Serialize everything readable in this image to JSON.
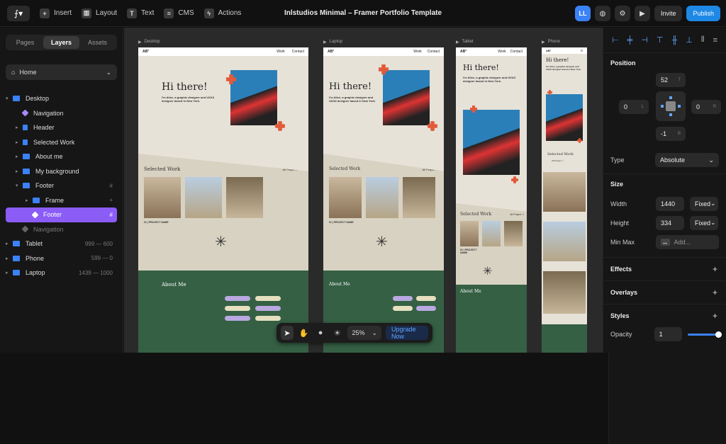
{
  "app": {
    "title": "Inlstudios Minimal – Framer Portfolio Template"
  },
  "topbar": {
    "insert": "Insert",
    "layout": "Layout",
    "text": "Text",
    "cms": "CMS",
    "actions": "Actions",
    "avatar": "LL",
    "invite": "Invite",
    "publish": "Publish"
  },
  "left_panel": {
    "tabs": [
      "Pages",
      "Layers",
      "Assets"
    ],
    "active_tab": "Layers",
    "page": "Home",
    "layers": [
      {
        "label": "Desktop",
        "tag": "Primary",
        "depth": 0
      },
      {
        "label": "Navigation",
        "depth": 1
      },
      {
        "label": "Header",
        "depth": 1
      },
      {
        "label": "Selected Work",
        "depth": 1
      },
      {
        "label": "About me",
        "depth": 1
      },
      {
        "label": "My background",
        "depth": 1
      },
      {
        "label": "Footer",
        "depth": 1,
        "tag": "#"
      },
      {
        "label": "Frame",
        "depth": 2,
        "tag": "+"
      },
      {
        "label": "Footer",
        "depth": 2,
        "tag": "#",
        "selected": true
      },
      {
        "label": "Navigation",
        "depth": 1,
        "dim": true
      },
      {
        "label": "Tablet",
        "tag": "999 — 600",
        "depth": 0
      },
      {
        "label": "Phone",
        "tag": "599 — 0",
        "depth": 0
      },
      {
        "label": "Laptop",
        "tag": "1439 — 1000",
        "depth": 0
      }
    ]
  },
  "canvas": {
    "frames": [
      {
        "label": "Desktop",
        "logo": "AB°",
        "nav_work": "Work",
        "nav_contact": "Contact",
        "hero_title": "Hi there!",
        "hero_sub": "I'm Alice, a graphic designer and UX/UI designer based in New York.",
        "work_title": "Selected Work",
        "all_projects": "All Project ↗",
        "project_name": "01 | PROJECT NAME",
        "about_title": "About Me"
      },
      {
        "label": "Laptop",
        "logo": "AB°",
        "nav_work": "Work",
        "nav_contact": "Contact",
        "hero_title": "Hi there!",
        "hero_sub": "I'm Alice, a graphic designer and UX/UI designer based in New York.",
        "work_title": "Selected Work",
        "all_projects": "All Project ↗",
        "project_name": "01 | PROJECT NAME",
        "about_title": "About Me"
      },
      {
        "label": "Tablet",
        "logo": "AB°",
        "nav_work": "Work",
        "nav_contact": "Contact",
        "hero_title": "Hi there!",
        "hero_sub": "I'm Alice, a graphic designer and UX/UI designer based in New York.",
        "work_title": "Selected Work",
        "all_projects": "All Project ↗",
        "project_name": "01 | PROJECT NAME",
        "about_title": "About Me"
      },
      {
        "label": "Phone",
        "logo": "AB°",
        "hero_title": "Hi there!",
        "hero_sub": "I'm Alice, a graphic designer and UX/UI designer based in New York.",
        "work_title": "Selected Work",
        "all_projects": "All Project ↗"
      }
    ],
    "pills": [
      "Visual Design",
      "Communication",
      "Keyboard",
      "User Research",
      "UX & Design",
      "Problem-solving"
    ]
  },
  "bottom_toolbar": {
    "zoom": "25%",
    "upgrade": "Upgrade Now"
  },
  "right_panel": {
    "position_title": "Position",
    "top": "52",
    "top_label": "T",
    "left": "0",
    "left_label": "L",
    "right": "0",
    "right_label": "R",
    "bottom": "-1",
    "bottom_label": "B",
    "type_label": "Type",
    "type_value": "Absolute",
    "size_title": "Size",
    "width_label": "Width",
    "width_value": "1440",
    "width_mode": "Fixed",
    "height_label": "Height",
    "height_value": "334",
    "height_mode": "Fixed",
    "minmax_label": "Min Max",
    "minmax_value": "Add...",
    "effects": "Effects",
    "overlays": "Overlays",
    "styles": "Styles",
    "opacity_label": "Opacity",
    "opacity_value": "1"
  },
  "colors": {
    "accent": "#1e88e5",
    "selection": "#8b5cf6",
    "footer_green": "#356044"
  }
}
